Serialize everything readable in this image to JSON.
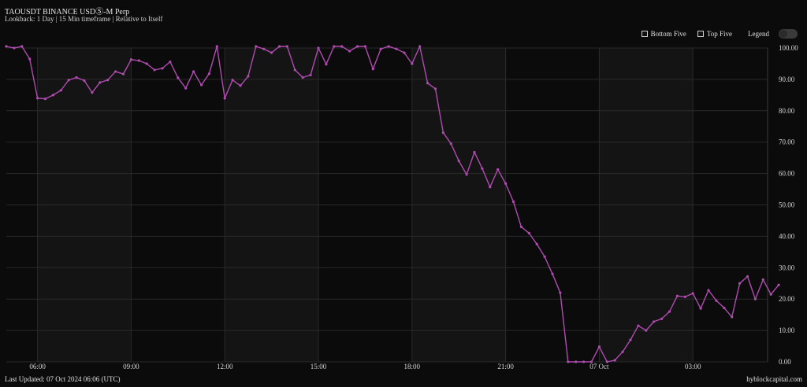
{
  "header": {
    "title": "TAOUSDT BINANCE USDⓈ-M Perp",
    "subtitle": "Lookback: 1 Day | 15 Min timeframe | Relative to Itself"
  },
  "controls": {
    "bottom_five": "Bottom Five",
    "top_five": "Top Five",
    "legend": "Legend"
  },
  "footer": {
    "last_updated": "Last Updated: 07 Oct 2024 06:06 (UTC)",
    "brand": "hyblockcapital.com"
  },
  "colors": {
    "line": "#b04bb0",
    "background": "#0b0b0b",
    "band_alt": "#141414",
    "grid": "#2a2a2a"
  },
  "chart_data": {
    "type": "line",
    "title": "",
    "xlabel": "",
    "ylabel": "",
    "ylim": [
      0,
      100
    ],
    "yticks": [
      "0.00",
      "10.00",
      "20.00",
      "30.00",
      "40.00",
      "50.00",
      "60.00",
      "70.00",
      "80.00",
      "90.00",
      "100.00"
    ],
    "xtick_labels": [
      "06:00",
      "09:00",
      "12:00",
      "15:00",
      "18:00",
      "21:00",
      "07 Oct",
      "03:00"
    ],
    "x_start": "06 Oct 05:00",
    "x_step_minutes": 15,
    "grid": true,
    "series": [
      {
        "values": [
          100.5,
          100.0,
          100.5,
          96.5,
          84.0,
          83.8,
          85.0,
          86.5,
          89.8,
          90.6,
          89.6,
          85.8,
          89.0,
          89.8,
          92.5,
          91.7,
          96.3,
          96.0,
          95.0,
          93.0,
          93.5,
          95.6,
          90.5,
          87.2,
          92.5,
          88.2,
          91.8,
          100.5,
          84.0,
          89.8,
          88.0,
          91.0,
          100.5,
          99.7,
          98.5,
          100.5,
          100.5,
          93.0,
          90.6,
          91.4,
          100.0,
          94.8,
          100.5,
          100.5,
          99.0,
          100.5,
          100.5,
          93.3,
          99.7,
          100.5,
          99.7,
          98.5,
          95.0,
          100.5,
          88.8,
          87.0,
          73.0,
          69.5,
          64.0,
          59.7,
          66.8,
          61.6,
          55.7,
          61.3,
          56.8,
          51.0,
          43.0,
          41.0,
          37.5,
          33.5,
          28.0,
          22.0,
          0,
          0,
          0,
          0,
          4.8,
          0,
          0.5,
          3.2,
          7.0,
          11.5,
          10.0,
          12.8,
          13.7,
          16.0,
          21.0,
          20.7,
          21.8,
          17.0,
          22.8,
          19.5,
          17.2,
          14.3,
          25.0,
          27.2,
          20.0,
          26.2,
          21.5,
          24.5
        ]
      }
    ]
  }
}
